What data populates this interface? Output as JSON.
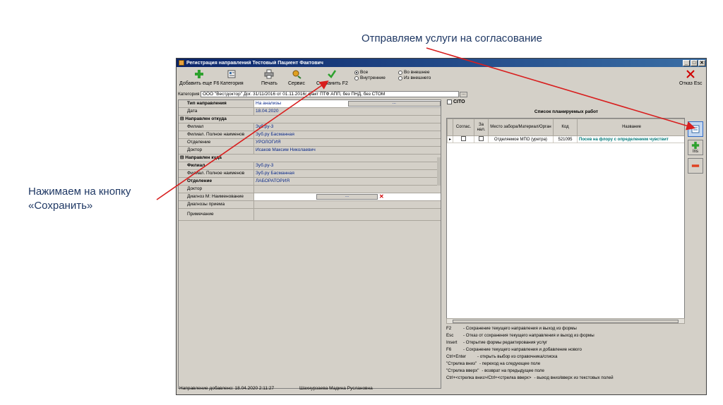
{
  "annotations": {
    "top": "Отправляем услуги на согласование",
    "left": "Нажимаем на кнопку «Сохранить»"
  },
  "window": {
    "title": "Регистрация направлений Тестовый Пациент Фактович",
    "controls": [
      "_",
      "□",
      "✕"
    ]
  },
  "toolbar": {
    "add_more": "Добавить еще F6",
    "category": "Категория",
    "print": "Печать",
    "service": "Сервис",
    "save": "Сохранить F2",
    "cancel": "Отказ Esc",
    "radios": [
      {
        "label": "Все",
        "checked": true
      },
      {
        "label": "Во внешнее",
        "checked": false
      },
      {
        "label": "Внутренние",
        "checked": false
      },
      {
        "label": "Из внешнего",
        "checked": false
      }
    ]
  },
  "category_field": {
    "label": "Категория",
    "value": "ООО \"Вестдоктор\" Дог. 31/11/2016 от 01.11.2016г факт ПТФ АПП, без ПНД, без СТОМ"
  },
  "form": {
    "type_label": "Тип направления",
    "type_value": "На анализы",
    "date_label": "Дата",
    "date_value": "18.04.2020",
    "from_section": "Направлен откуда",
    "from_branch_label": "Филиал",
    "from_branch_value": "Зуб.ру-3",
    "from_branch_full_label": "Филиал. Полное наименов",
    "from_branch_full_value": "Зуб.ру Басманная",
    "from_dept_label": "Отделение",
    "from_dept_value": "УРОЛОГИЯ",
    "from_doctor_label": "Доктор",
    "from_doctor_value": "Исаков Максим Николаевич",
    "to_section": "Направлен куда",
    "to_branch_label": "Филиал",
    "to_branch_value": "Зуб.ру-3",
    "to_branch_full_label": "Филиал. Полное наименов",
    "to_branch_full_value": "Зуб.ру Басманная",
    "to_dept_label": "Отделение",
    "to_dept_value": "ЛАБОРАТОРИЯ",
    "to_doctor_label": "Доктор",
    "diagnosis_label": "Диагноз М: Наименование",
    "reception_diag_label": "Диагнозы приема",
    "note_label": "Примечание"
  },
  "cito_label": "CITO",
  "works": {
    "title": "Список планируемых работ",
    "columns": [
      "Соглас.",
      "За нал.",
      "Место забора/Материал/Орган",
      "Код",
      "Название"
    ],
    "rows": [
      {
        "place": "Отделяемое МПО (уретра)",
        "code": "521095",
        "name": "Посев на флору с определением чувствит"
      }
    ]
  },
  "side": {
    "ins_label": "Ins"
  },
  "help": [
    {
      "key": "F2",
      "text": "- Сохранение текущего направления и выход из формы"
    },
    {
      "key": "Esc",
      "text": "- Отказ от сохранения текущего направления и выход из формы"
    },
    {
      "key": "Insert",
      "text": "- Открытие формы редактирования услуг"
    },
    {
      "key": "F6",
      "text": "- Сохранение текущего направления и добавление нового"
    },
    {
      "key": "Ctrl+Enter",
      "text": "- открыть выбор из справочника/списка"
    },
    {
      "key": "\"Стрелка вниз\"",
      "text": "- переход на следующее поле"
    },
    {
      "key": "\"Стрелка вверх\"",
      "text": "- возврат на предыдущее поле"
    },
    {
      "key": "Ctrl+<стрелка вниз>/Ctrl+<стрелка вверх>",
      "text": "- выход вниз/вверх из текстовых полей"
    }
  ],
  "status": {
    "added": "Направление добавлено: 18.04.2020 2:11:27",
    "user": "Шахнурзаева Мадина Руслановна"
  }
}
